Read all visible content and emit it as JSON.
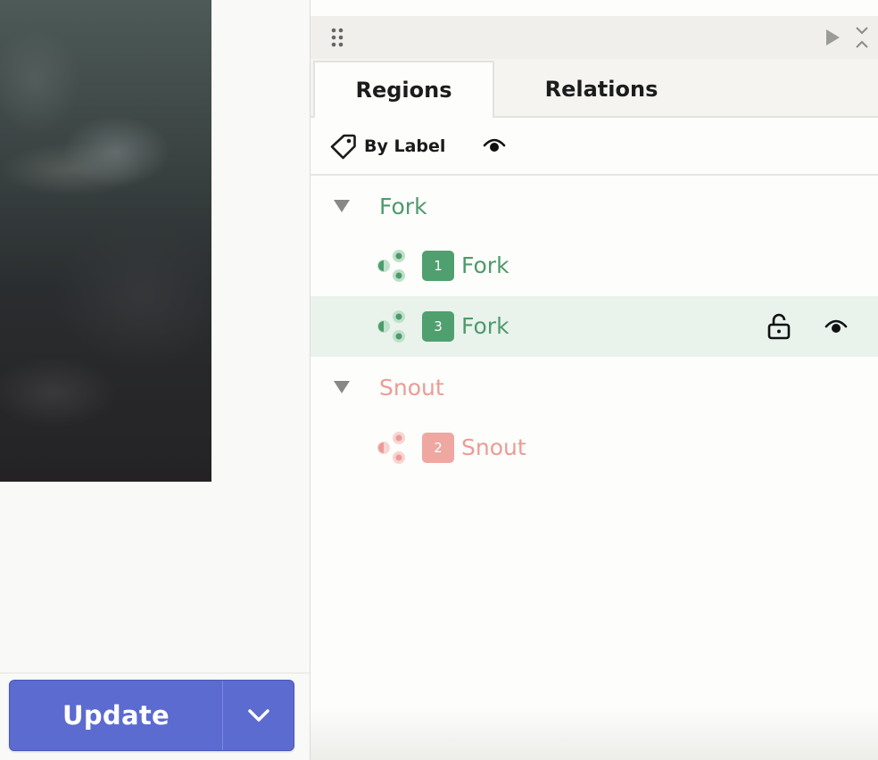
{
  "left": {
    "update_button": {
      "label": "Update"
    }
  },
  "panel": {
    "tabs": [
      {
        "label": "Regions",
        "active": true
      },
      {
        "label": "Relations",
        "active": false
      }
    ],
    "toolbar": {
      "group_by_label": "By Label"
    },
    "groups": [
      {
        "label": "Fork",
        "color": "#4e9a6b",
        "regions": [
          {
            "index": "1",
            "label": "Fork",
            "selected": false
          },
          {
            "index": "3",
            "label": "Fork",
            "selected": true
          }
        ]
      },
      {
        "label": "Snout",
        "color": "#e8948e",
        "regions": [
          {
            "index": "2",
            "label": "Snout",
            "selected": false
          }
        ]
      }
    ]
  },
  "colors": {
    "accent_button": "#5b6bd0",
    "fork": "#4e9a6b",
    "fork_badge": "#4fa06e",
    "snout": "#eb9c96",
    "snout_badge": "#efa7a1",
    "selected_row": "#e9f3ec"
  },
  "icons": [
    "drag-handle-icon",
    "play-icon",
    "collapse-icon",
    "tag-icon",
    "eye-icon",
    "caret-down-icon",
    "region-node-icon",
    "lock-open-icon",
    "chevron-down-icon"
  ]
}
